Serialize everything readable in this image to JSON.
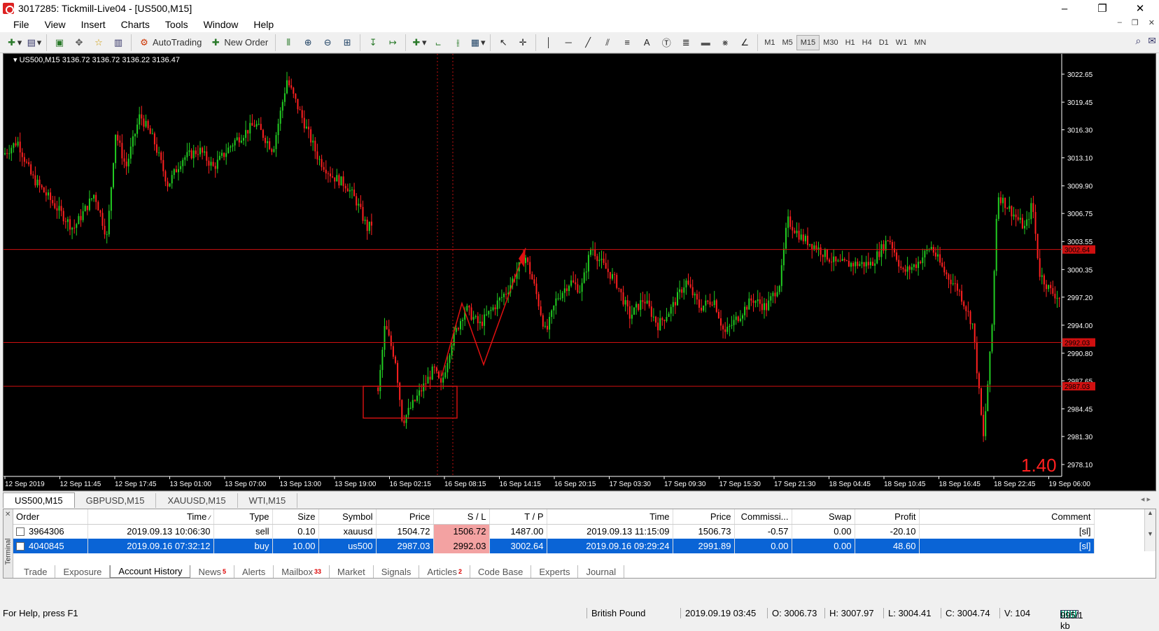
{
  "window": {
    "title": "3017285: Tickmill-Live04 - [US500,M15]"
  },
  "menu": [
    "File",
    "View",
    "Insert",
    "Charts",
    "Tools",
    "Window",
    "Help"
  ],
  "toolbar": {
    "autotrading": "AutoTrading",
    "new_order": "New Order",
    "timeframes": [
      "M1",
      "M5",
      "M15",
      "M30",
      "H1",
      "H4",
      "D1",
      "W1",
      "MN"
    ],
    "active_timeframe": "M15"
  },
  "chart": {
    "header": "US500,M15  3136.72 3136.72 3136.22 3136.47",
    "corner_value": "1.40",
    "price_labels": [
      "3022.65",
      "3019.45",
      "3016.30",
      "3013.10",
      "3009.90",
      "3006.75",
      "3003.55",
      "3000.35",
      "2997.20",
      "2994.00",
      "2990.80",
      "2987.65",
      "2984.45",
      "2981.30",
      "2978.10"
    ],
    "time_labels": [
      "12 Sep 2019",
      "12 Sep 11:45",
      "12 Sep 17:45",
      "13 Sep 01:00",
      "13 Sep 07:00",
      "13 Sep 13:00",
      "13 Sep 19:00",
      "16 Sep 02:15",
      "16 Sep 08:15",
      "16 Sep 14:15",
      "16 Sep 20:15",
      "17 Sep 03:30",
      "17 Sep 09:30",
      "17 Sep 15:30",
      "17 Sep 21:30",
      "18 Sep 04:45",
      "18 Sep 10:45",
      "18 Sep 16:45",
      "18 Sep 22:45",
      "19 Sep 06:00"
    ],
    "level_lines": [
      {
        "price": 3002.64,
        "label": "3002.64"
      },
      {
        "price": 2992.03,
        "label": "2992.03"
      },
      {
        "price": 2987.03,
        "label": "2987.03"
      }
    ],
    "colors": {
      "up": "#22cc22",
      "down": "#ff2020",
      "level": "#d01010",
      "background": "#000000"
    }
  },
  "chart_tabs": [
    "US500,M15",
    "GBPUSD,M15",
    "XAUUSD,M15",
    "WTI,M15"
  ],
  "terminal": {
    "label": "Terminal",
    "columns": [
      "Order",
      "Time",
      "Type",
      "Size",
      "Symbol",
      "Price",
      "S / L",
      "T / P",
      "Time",
      "Price",
      "Commissi...",
      "Swap",
      "Profit",
      "Comment"
    ],
    "rows": [
      [
        "3964306",
        "2019.09.13 10:06:30",
        "sell",
        "0.10",
        "xauusd",
        "1504.72",
        "1506.72",
        "1487.00",
        "2019.09.13 11:15:09",
        "1506.73",
        "-0.57",
        "0.00",
        "-20.10",
        "[sl]"
      ],
      [
        "4040845",
        "2019.09.16 07:32:12",
        "buy",
        "10.00",
        "us500",
        "2987.03",
        "2992.03",
        "3002.64",
        "2019.09.16 09:29:24",
        "2991.89",
        "0.00",
        "0.00",
        "48.60",
        "[sl]"
      ]
    ],
    "tabs": [
      {
        "label": "Trade"
      },
      {
        "label": "Exposure"
      },
      {
        "label": "Account History"
      },
      {
        "label": "News",
        "badge": "5"
      },
      {
        "label": "Alerts"
      },
      {
        "label": "Mailbox",
        "badge": "33"
      },
      {
        "label": "Market"
      },
      {
        "label": "Signals"
      },
      {
        "label": "Articles",
        "badge": "2"
      },
      {
        "label": "Code Base"
      },
      {
        "label": "Experts"
      },
      {
        "label": "Journal"
      }
    ],
    "active_tab": "Account History"
  },
  "status": {
    "help": "For Help, press F1",
    "profile": "British Pound",
    "datetime": "2019.09.19 03:45",
    "open": "O: 3006.73",
    "high": "H: 3007.97",
    "low": "L: 3004.41",
    "close": "C: 3004.74",
    "volume": "V: 104",
    "traffic": "995/1 kb"
  }
}
